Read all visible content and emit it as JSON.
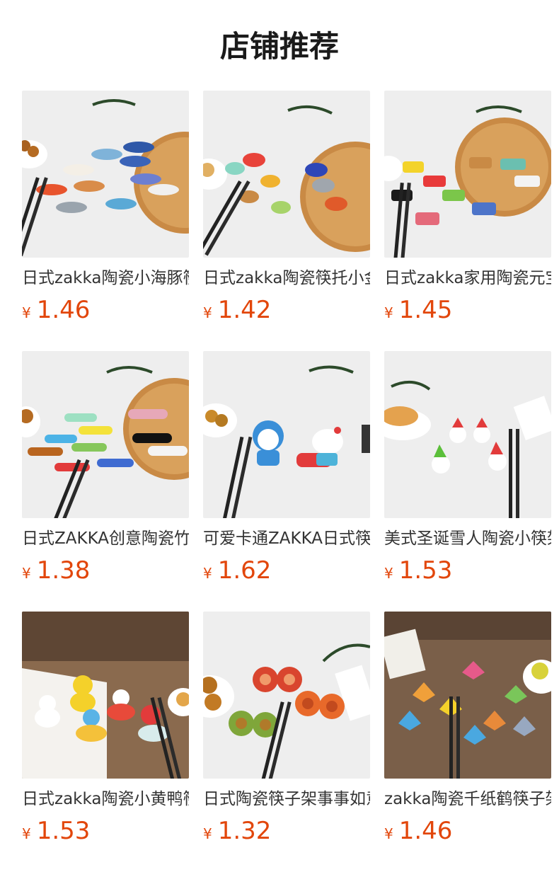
{
  "section": {
    "title": "店铺推荐"
  },
  "products": [
    {
      "name": "日式zakka陶瓷小海豚筷子架",
      "currency": "¥",
      "price": "1.46",
      "icon": "dolphin-chopstick-rest-image"
    },
    {
      "name": "日式zakka陶瓷筷托小金鱼",
      "currency": "¥",
      "price": "1.42",
      "icon": "goldfish-chopstick-rest-image"
    },
    {
      "name": "日式zakka家用陶瓷元宝筷架",
      "currency": "¥",
      "price": "1.45",
      "icon": "ingot-chopstick-rest-image"
    },
    {
      "name": "日式ZAKKA创意陶瓷竹节筷架",
      "currency": "¥",
      "price": "1.38",
      "icon": "bamboo-chopstick-rest-image"
    },
    {
      "name": "可爱卡通ZAKKA日式筷子架",
      "currency": "¥",
      "price": "1.62",
      "icon": "cartoon-chopstick-rest-image"
    },
    {
      "name": "美式圣诞雪人陶瓷小筷架",
      "currency": "¥",
      "price": "1.53",
      "icon": "snowman-chopstick-rest-image"
    },
    {
      "name": "日式zakka陶瓷小黄鸭筷架",
      "currency": "¥",
      "price": "1.53",
      "icon": "duck-chopstick-rest-image"
    },
    {
      "name": "日式陶瓷筷子架事事如意",
      "currency": "¥",
      "price": "1.32",
      "icon": "persimmon-chopstick-rest-image"
    },
    {
      "name": "zakka陶瓷千纸鹤筷子架",
      "currency": "¥",
      "price": "1.46",
      "icon": "paper-crane-chopstick-rest-image"
    }
  ]
}
